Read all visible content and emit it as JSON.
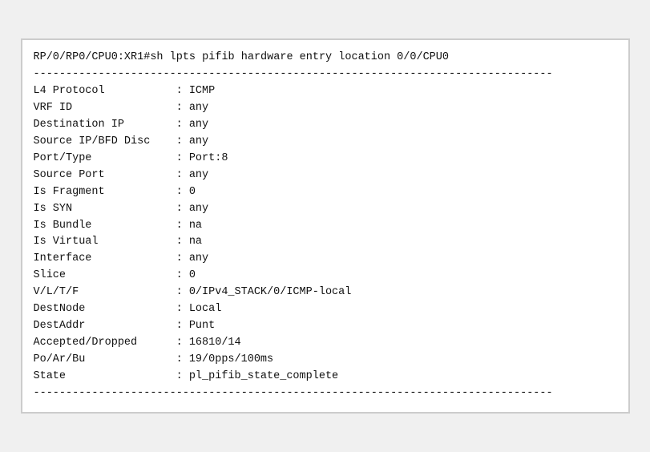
{
  "terminal": {
    "command": "RP/0/RP0/CPU0:XR1#sh lpts pifib hardware entry location 0/0/CPU0",
    "separator": "--------------------------------------------------------------------------------",
    "fields": [
      {
        "label": "L4 Protocol",
        "colon": ":",
        "value": "ICMP"
      },
      {
        "label": "VRF ID",
        "colon": ":",
        "value": "any"
      },
      {
        "label": "Destination IP",
        "colon": ":",
        "value": "any"
      },
      {
        "label": "Source IP/BFD Disc",
        "colon": ":",
        "value": "any"
      },
      {
        "label": "Port/Type",
        "colon": ":",
        "value": "Port:8"
      },
      {
        "label": "Source Port",
        "colon": ":",
        "value": "any"
      },
      {
        "label": "Is Fragment",
        "colon": ":",
        "value": "0"
      },
      {
        "label": "Is SYN",
        "colon": ":",
        "value": "any"
      },
      {
        "label": "Is Bundle",
        "colon": ":",
        "value": "na"
      },
      {
        "label": "Is Virtual",
        "colon": ":",
        "value": "na"
      },
      {
        "label": "Interface",
        "colon": ":",
        "value": "any"
      },
      {
        "label": "Slice",
        "colon": ":",
        "value": "0"
      },
      {
        "label": "V/L/T/F",
        "colon": ":",
        "value": "0/IPv4_STACK/0/ICMP-local"
      },
      {
        "label": "DestNode",
        "colon": ":",
        "value": "Local"
      },
      {
        "label": "DestAddr",
        "colon": ":",
        "value": "Punt"
      },
      {
        "label": "Accepted/Dropped",
        "colon": ":",
        "value": "16810/14"
      },
      {
        "label": "Po/Ar/Bu",
        "colon": ":",
        "value": "19/0pps/100ms"
      },
      {
        "label": "State",
        "colon": ":",
        "value": "pl_pifib_state_complete"
      }
    ],
    "separator_bottom": "--------------------------------------------------------------------------------"
  }
}
